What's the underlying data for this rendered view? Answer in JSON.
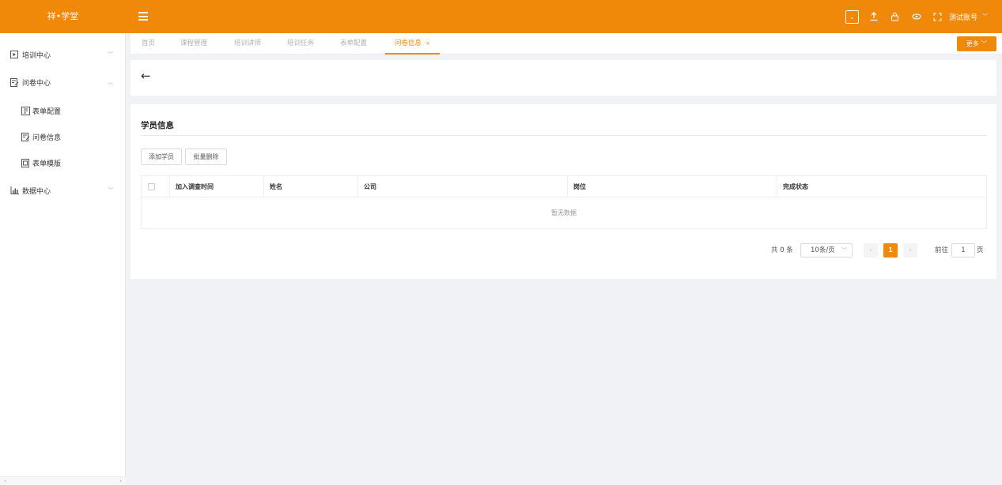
{
  "app": {
    "logo": "祥•学堂",
    "account": "测试账号"
  },
  "icons": {
    "menu": "hamburger-icon",
    "dropdown": "dropdown-box-icon",
    "upload": "upload-icon",
    "lock": "lock-icon",
    "eye": "eye-icon",
    "fullscreen": "fullscreen-icon"
  },
  "colors": {
    "brand": "#f0880a"
  },
  "sidebar": {
    "items": [
      {
        "label": "培训中心",
        "icon": "play-box-icon",
        "expanded": false
      },
      {
        "label": "问卷中心",
        "icon": "form-edit-icon",
        "expanded": true,
        "children": [
          {
            "label": "表单配置",
            "icon": "form-config-icon"
          },
          {
            "label": "问卷信息",
            "icon": "form-info-icon"
          },
          {
            "label": "表单模版",
            "icon": "form-template-icon"
          }
        ]
      },
      {
        "label": "数据中心",
        "icon": "bar-chart-icon",
        "expanded": false
      }
    ]
  },
  "tabs": {
    "items": [
      {
        "label": "首页"
      },
      {
        "label": "课程管理"
      },
      {
        "label": "培训讲师"
      },
      {
        "label": "培训任务"
      },
      {
        "label": "表单配置"
      },
      {
        "label": "问卷信息",
        "active": true,
        "close": "×"
      }
    ],
    "more_label": "更多"
  },
  "page": {
    "back_icon": "back-arrow-icon",
    "section_title": "学员信息",
    "buttons": {
      "add": "添加学员",
      "batch_delete": "批量删除"
    },
    "table": {
      "columns": [
        "加入调查时间",
        "姓名",
        "公司",
        "岗位",
        "完成状态"
      ],
      "empty_text": "暂无数据"
    },
    "pagination": {
      "total": "共 0 条",
      "page_size": "10条/页",
      "current_page": "1",
      "goto_label": "前往",
      "goto_value": "1",
      "page_suffix": "页"
    }
  }
}
